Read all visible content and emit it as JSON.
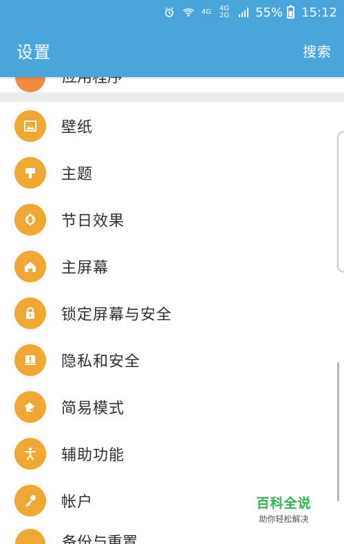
{
  "status_bar": {
    "network_labels": [
      "4G",
      "4G",
      "2G"
    ],
    "battery": "55%",
    "time": "15:12",
    "icons": [
      "alarm-icon",
      "wifi-icon",
      "signal-icon",
      "battery-icon"
    ]
  },
  "app_bar": {
    "title": "设置",
    "search_label": "搜索",
    "color": "#4aa6da"
  },
  "top_partial": {
    "label": "应用程序"
  },
  "settings": [
    {
      "label": "壁纸",
      "icon": "wallpaper-icon"
    },
    {
      "label": "主题",
      "icon": "theme-icon"
    },
    {
      "label": "节日效果",
      "icon": "lantern-icon"
    },
    {
      "label": "主屏幕",
      "icon": "home-icon"
    },
    {
      "label": "锁定屏幕与安全",
      "icon": "lock-icon"
    },
    {
      "label": "隐私和安全",
      "icon": "privacy-icon"
    },
    {
      "label": "简易模式",
      "icon": "easy-mode-icon"
    },
    {
      "label": "辅助功能",
      "icon": "accessibility-icon"
    },
    {
      "label": "帐户",
      "icon": "key-icon"
    }
  ],
  "bottom_partial": {
    "label": "备份与重置"
  },
  "watermark": {
    "title": "百科全说",
    "subtitle": "助你轻松解决"
  },
  "colors": {
    "icon_circle": "#eea833",
    "background": "#f6f6f6",
    "text": "#303030"
  }
}
